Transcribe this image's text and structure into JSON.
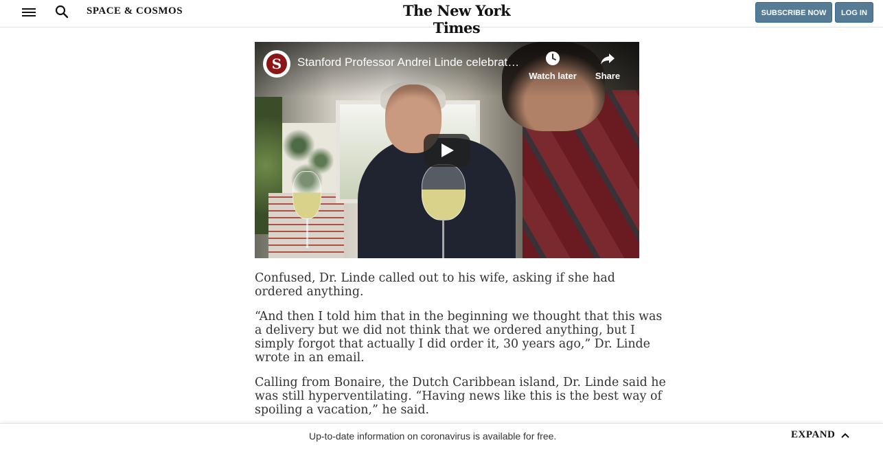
{
  "header": {
    "section": "SPACE & COSMOS",
    "logo": "The New York Times",
    "subscribe_label": "SUBSCRIBE NOW",
    "login_label": "LOG IN"
  },
  "video": {
    "channel_logo_letter": "S",
    "title": "Stanford Professor Andrei Linde celebrates physics breakthrough",
    "watch_later_label": "Watch later",
    "share_label": "Share"
  },
  "article": {
    "paragraphs": [
      "Confused, Dr. Linde called out to his wife, asking if she had ordered anything.",
      "“And then I told him that in the beginning we thought that this was a delivery but we did not think that we ordered anything, but I simply forgot that actually I did order it, 30 years ago,” Dr. Linde wrote in an email.",
      "Calling from Bonaire, the Dutch Caribbean island, Dr. Linde said he was still hyperventilating. “Having news like this is the best way of spoiling a vacation,” he said."
    ]
  },
  "footer": {
    "notice": "Up-to-date information on coronavirus is available for free.",
    "expand_label": "EXPAND"
  }
}
